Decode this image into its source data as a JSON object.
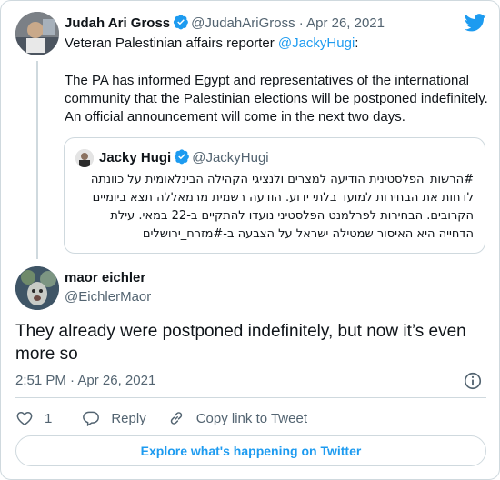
{
  "parent_tweet": {
    "author_name": "Judah Ari Gross",
    "handle": "@JudahAriGross",
    "separator": "·",
    "date": "Apr 26, 2021",
    "bio_prefix": "Veteran Palestinian affairs reporter ",
    "bio_mention": "@JackyHugi",
    "bio_suffix": ":",
    "text": "The PA has informed Egypt and representatives of the international community that the Palestinian elections will be postponed indefinitely. An official announcement will come in the next two days."
  },
  "quoted_tweet": {
    "author_name": "Jacky Hugi",
    "handle": "@JackyHugi",
    "text": "#הרשות_הפלסטינית הודיעה למצרים ולנציגי הקהילה הבינלאומית על כוונתה לדחות את הבחירות למועד בלתי ידוע. הודעה רשמית מרמאללה תצא ביומיים הקרובים. הבחירות לפרלמנט הפלסטיני נועדו להתקיים ב-22 במאי. עילת הדחייה היא האיסור שמטילה ישראל על הצבעה ב-#מזרח_ירושלים"
  },
  "reply_tweet": {
    "author_name": "maor eichler",
    "handle": "@EichlerMaor",
    "text": "They already were postponed indefinitely, but now it’s even more so",
    "time": "2:51 PM",
    "separator": "·",
    "date": "Apr 26, 2021"
  },
  "actions": {
    "like_count": "1",
    "reply_label": "Reply",
    "copy_link_label": "Copy link to Tweet"
  },
  "explore_button_label": "Explore what's happening on Twitter",
  "colors": {
    "accent": "#1d9bf0",
    "text": "#0f1419",
    "muted": "#536471",
    "border": "#cfd9de"
  },
  "icons": [
    "twitter-bird-icon",
    "verified-badge-icon",
    "info-icon",
    "heart-icon",
    "reply-bubble-icon",
    "link-icon"
  ]
}
